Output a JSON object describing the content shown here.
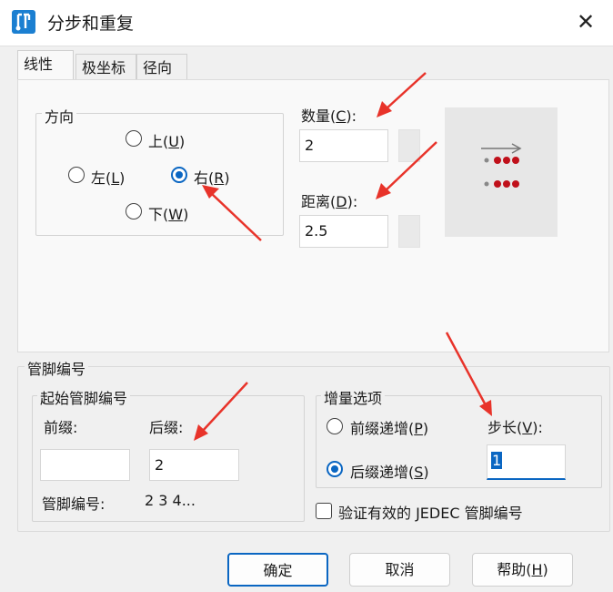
{
  "window": {
    "title": "分步和重复",
    "close_glyph": "✕"
  },
  "tabs": [
    {
      "label": "线性",
      "active": true
    },
    {
      "label": "极坐标",
      "active": false
    },
    {
      "label": "径向",
      "active": false
    }
  ],
  "direction": {
    "legend": "方向",
    "up": {
      "text": "上(",
      "key": "U",
      "close": ")"
    },
    "left": {
      "text": "左(",
      "key": "L",
      "close": ")"
    },
    "right": {
      "text": "右(",
      "key": "R",
      "close": ")",
      "checked": true
    },
    "down": {
      "text": "下(",
      "key": "W",
      "close": ")"
    }
  },
  "count": {
    "text": "数量(",
    "key": "C",
    "close": "):",
    "value": "2"
  },
  "distance": {
    "text": "距离(",
    "key": "D",
    "close": "):",
    "value": "2.5"
  },
  "pin_numbering": {
    "legend": "管脚编号",
    "start": {
      "legend": "起始管脚编号",
      "prefix_label": "前缀:",
      "prefix_value": "",
      "suffix_label": "后缀:",
      "suffix_value": "2",
      "pin_label": "管脚编号:",
      "pin_preview": "2 3 4..."
    },
    "increment": {
      "legend": "增量选项",
      "prefix_inc": {
        "text": "前缀递增(",
        "key": "P",
        "close": ")"
      },
      "suffix_inc": {
        "text": "后缀递增(",
        "key": "S",
        "close": ")",
        "checked": true
      },
      "step": {
        "text": "步长(",
        "key": "V",
        "close": "):",
        "value": "1"
      }
    },
    "jedec": {
      "label": "验证有效的 JEDEC 管脚编号",
      "checked": false
    }
  },
  "buttons": {
    "ok": "确定",
    "cancel": "取消",
    "help": {
      "text": "帮助(",
      "key": "H",
      "close": ")"
    }
  },
  "colors": {
    "accent": "#0a66c2",
    "annotation_arrow": "#e8332a",
    "pad_red": "#c0101a"
  }
}
